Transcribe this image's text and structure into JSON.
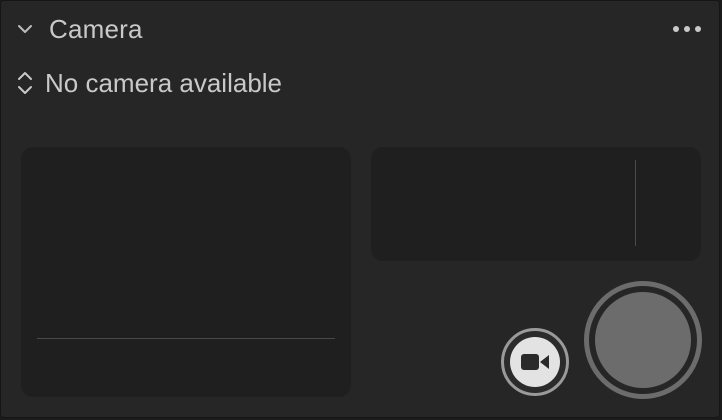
{
  "header": {
    "title": "Camera"
  },
  "camera_selector": {
    "value": "No camera available"
  },
  "icons": {
    "collapse": "chevron-down-icon",
    "menu": "more-horizontal-icon",
    "selector": "chevron-up-down-icon",
    "video": "video-camera-icon"
  },
  "colors": {
    "panel_background": "#262626",
    "pad_background": "#1f1f1f",
    "text": "#c9c9c9",
    "shutter": "#6c6c6c"
  }
}
